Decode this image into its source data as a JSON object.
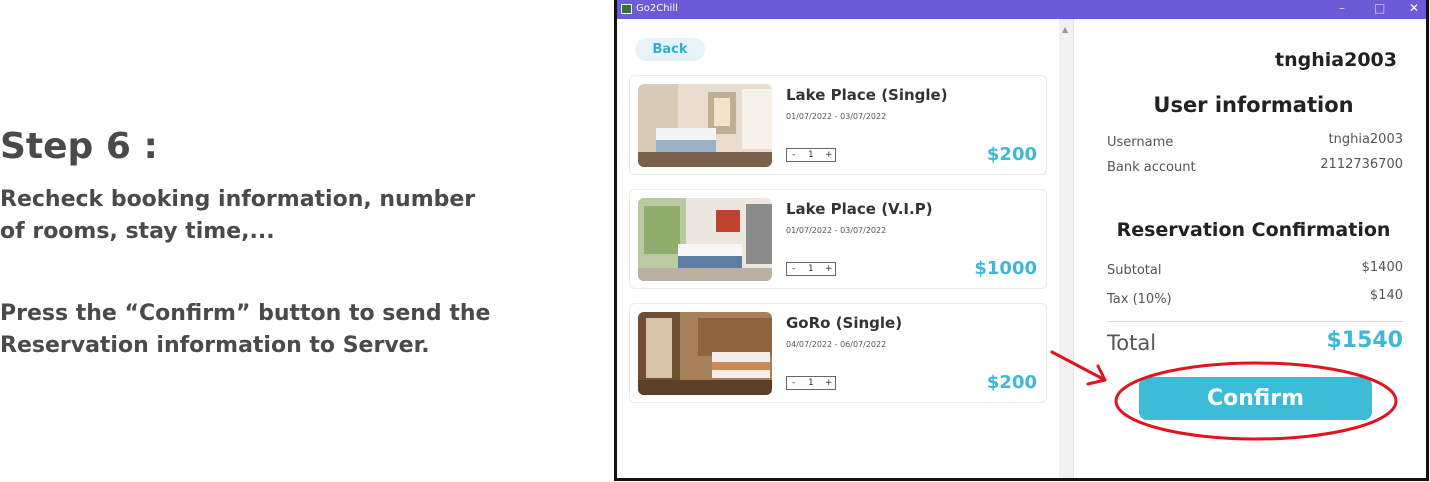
{
  "instructions": {
    "step_title": "Step 6 :",
    "para1_line1": "Recheck booking information, number",
    "para1_line2": "of rooms, stay time,...",
    "para2_line1": "Press the “Confirm” button to send the",
    "para2_line2": "Reservation information to Server."
  },
  "window": {
    "title": "Go2Chill",
    "controls": {
      "minimize": "–",
      "maximize": "□",
      "close": "✕"
    }
  },
  "back_label": "Back",
  "rooms": [
    {
      "name": "Lake Place (Single)",
      "dates": "01/07/2022 - 03/07/2022",
      "minus": "-",
      "qty": "1",
      "plus": "+",
      "price": "$200"
    },
    {
      "name": "Lake Place (V.I.P)",
      "dates": "01/07/2022 - 03/07/2022",
      "minus": "-",
      "qty": "1",
      "plus": "+",
      "price": "$1000"
    },
    {
      "name": "GoRo (Single)",
      "dates": "04/07/2022 - 06/07/2022",
      "minus": "-",
      "qty": "1",
      "plus": "+",
      "price": "$200"
    }
  ],
  "panel": {
    "username_header": "tnghia2003",
    "user_info_title": "User information",
    "username_label": "Username",
    "username_value": "tnghia2003",
    "bank_label": "Bank account",
    "bank_value": "2112736700",
    "reservation_title": "Reservation Confirmation",
    "subtotal_label": "Subtotal",
    "subtotal_value": "$1400",
    "tax_label": "Tax (10%)",
    "tax_value": "$140",
    "total_label": "Total",
    "total_value": "$1540",
    "confirm_label": "Confirm"
  },
  "colors": {
    "accent": "#3cbcd7",
    "titlebar": "#6b5bd6",
    "annotation": "#e0141e"
  }
}
